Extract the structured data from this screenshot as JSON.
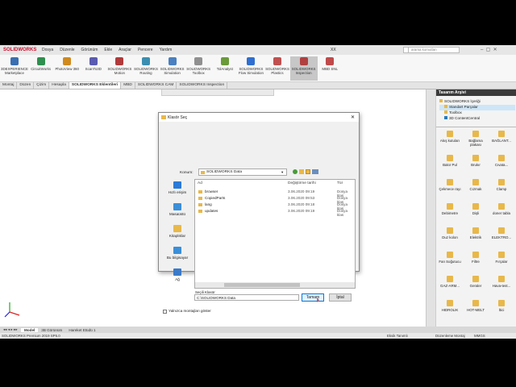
{
  "app": {
    "logo_text": "SOLIDWORKS",
    "menus": [
      "Dosya",
      "Düzenle",
      "Görünüm",
      "Ekle",
      "Araçlar",
      "Pencere",
      "Yardım"
    ],
    "doc_title": "XX",
    "search_placeholder": "arama komutları",
    "accent": "#c8102e"
  },
  "ribbon": [
    {
      "label": "3DEXPERIENCE Marketplace",
      "color": "#3a6fb0"
    },
    {
      "label": "CircuitWorks",
      "color": "#2f8f4e"
    },
    {
      "label": "PhotoView 360",
      "color": "#d08a1e"
    },
    {
      "label": "ScanTo3D",
      "color": "#5a5ab0"
    },
    {
      "label": "SOLIDWORKS Motion",
      "color": "#b03a3a"
    },
    {
      "label": "SOLIDWORKS Routing",
      "color": "#3a8fb0"
    },
    {
      "label": "SOLIDWORKS Simulation",
      "color": "#4a7fc0"
    },
    {
      "label": "SOLIDWORKS Toolbox",
      "color": "#909090"
    },
    {
      "label": "TolAnalyst",
      "color": "#6a9a3a"
    },
    {
      "label": "SOLIDWORKS Flow Simulation",
      "color": "#2f6fd0"
    },
    {
      "label": "SOLIDWORKS Plastics",
      "color": "#c05050"
    },
    {
      "label": "SOLIDWORKS Inspection",
      "color": "#b04040"
    },
    {
      "label": "MBD SNL",
      "color": "#c04a4a"
    }
  ],
  "command_tabs": [
    "Montaj",
    "Düzen",
    "Çizim",
    "Hesapla",
    "SOLIDWORKS Eklentileri",
    "MBD",
    "SOLIDWORKS CAM",
    "SOLIDWORKS Inspection"
  ],
  "command_tabs_active": 4,
  "taskpane": {
    "title": "Tasarım Arşivi",
    "tree": [
      "SOLIDWORKS İçeriği",
      "Standart Parçalar",
      "Toolbox",
      "3D ContentCentral"
    ],
    "items": [
      "Akış kutuları",
      "Bağlama plakası",
      "BAĞLANT...",
      "Bakır Pul",
      "Brukır",
      "Cıvata...",
      "Çekmece rayı",
      "Cızmak",
      "Clamp",
      "Debimetre",
      "Dişli",
      "doner tabla",
      "Duz kolon",
      "Elektrik",
      "ELEKTRO...",
      "Fan Soğutucu",
      "Filtre",
      "Fırçalar",
      "GAZ-ARM...",
      "Geraler",
      "Hava-test...",
      "HIDROLIK",
      "HOT-MELT",
      "İtici"
    ]
  },
  "bottom_tabs": [
    "Model",
    "3B Görünüm",
    "Hareket Etüdü 1"
  ],
  "status": {
    "left": "SOLIDWORKS Premium 2019 SP5.0",
    "mid": "Eksik Tanımlı",
    "right": "Düzenleme Montaj",
    "units": "MMGS"
  },
  "dialog": {
    "title": "Klasör Seç",
    "look_in_label": "Konum:",
    "look_in_value": "SOLIDWORKS Data",
    "places": [
      "Hızlı erişim",
      "Masaüstü",
      "Kitaplıklar",
      "Bu bilgisayar",
      "Ağ"
    ],
    "col_name": "Ad",
    "col_date": "Değiştirme tarihi",
    "col_type": "Tür",
    "files": [
      {
        "name": "browser",
        "date": "3.06.2020 09:19",
        "type": "Dosya klas"
      },
      {
        "name": "CopiedParts",
        "date": "3.06.2020 09:53",
        "type": "Dosya klas"
      },
      {
        "name": "lang",
        "date": "3.06.2020 09:18",
        "type": "Dosya klas"
      },
      {
        "name": "updates",
        "date": "3.06.2020 09:19",
        "type": "Dosya klas"
      }
    ],
    "selected_label": "Seçili Klasör",
    "selected_value": "C:\\SOLIDWORKS Data",
    "ok": "Tamam",
    "cancel": "İptal",
    "checkbox": "Yalnızca montajları göster"
  }
}
